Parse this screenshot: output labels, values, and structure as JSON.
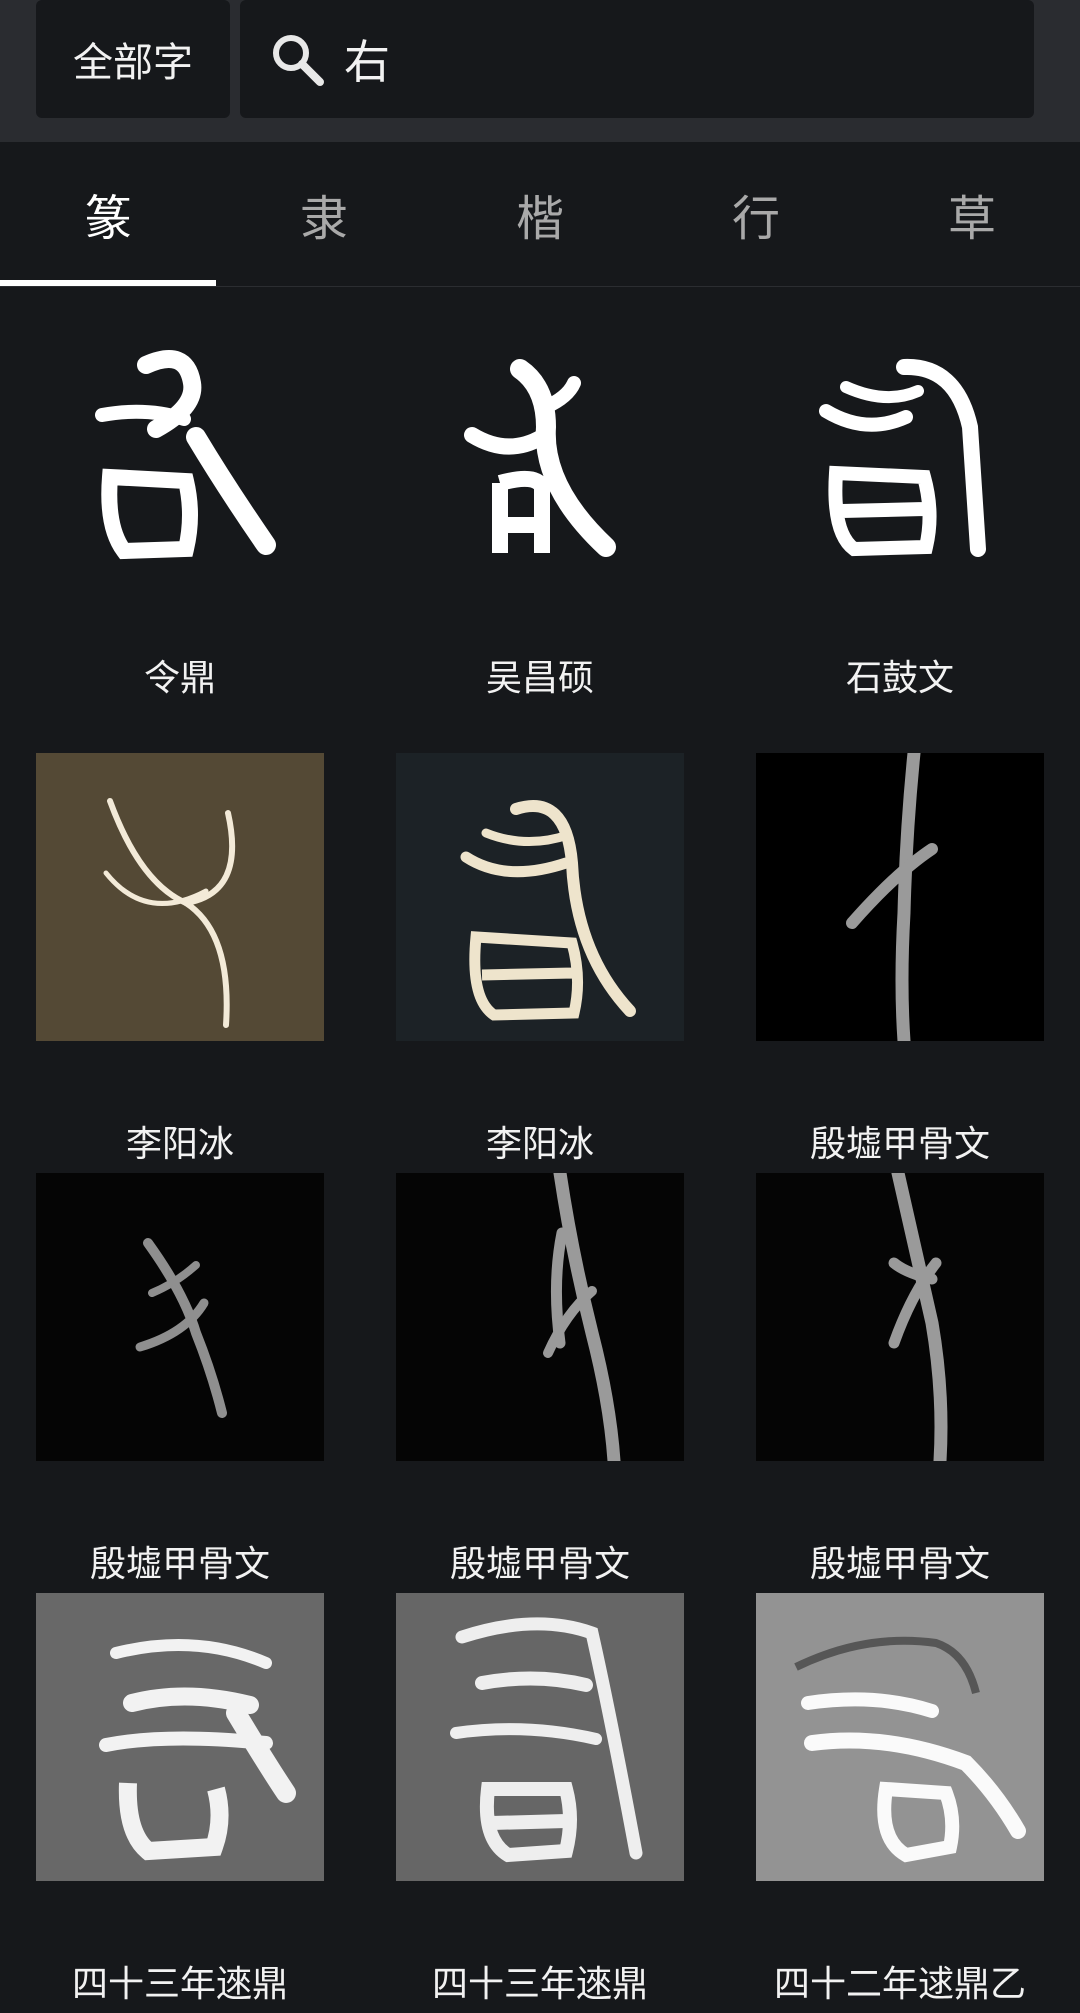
{
  "header": {
    "scope_label": "全部字",
    "search_value": "右"
  },
  "tabs": [
    {
      "label": "篆",
      "active": true
    },
    {
      "label": "隶",
      "active": false
    },
    {
      "label": "楷",
      "active": false
    },
    {
      "label": "行",
      "active": false
    },
    {
      "label": "草",
      "active": false
    }
  ],
  "results": [
    {
      "source": "令鼎",
      "style": "white-on-dark"
    },
    {
      "source": "吴昌硕",
      "style": "white-on-dark"
    },
    {
      "source": "石鼓文",
      "style": "white-on-dark"
    },
    {
      "source": "李阳冰",
      "style": "ink-on-brown-paper"
    },
    {
      "source": "李阳冰",
      "style": "ink-on-dark-blue"
    },
    {
      "source": "殷墟甲骨文",
      "style": "grey-on-black"
    },
    {
      "source": "殷墟甲骨文",
      "style": "grey-on-black"
    },
    {
      "source": "殷墟甲骨文",
      "style": "grey-on-black"
    },
    {
      "source": "殷墟甲骨文",
      "style": "grey-on-black"
    },
    {
      "source": "四十三年逨鼎",
      "style": "rubbing"
    },
    {
      "source": "四十三年逨鼎",
      "style": "rubbing"
    },
    {
      "source": "四十二年逑鼎乙",
      "style": "rubbing"
    }
  ],
  "colors": {
    "background": "#16181b",
    "topbar": "#2a2c30",
    "active_tab": "#ffffff",
    "inactive_tab": "#a9a9a9"
  }
}
